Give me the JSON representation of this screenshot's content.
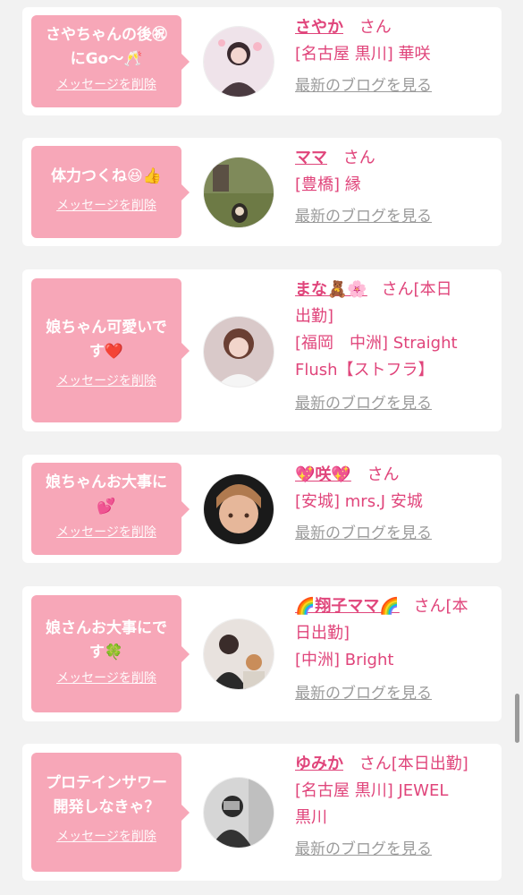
{
  "colors": {
    "accent_pink": "#e0457b",
    "bubble_pink": "#f7a7b8",
    "link_gray": "#9b9b9b",
    "page_bg": "#f2f2f2",
    "card_bg": "#ffffff"
  },
  "messages": [
    {
      "message_lines": [
        "さやちゃんの後㊗",
        "にGo〜🥂"
      ],
      "delete_label": "メッセージを削除",
      "name": "さやか",
      "honorific": "さん",
      "shop_lines": [
        "[名古屋 黒川] 華咲"
      ],
      "blog_label": "最新のブログを見る",
      "avatar_icon": "avatar-photo-icon"
    },
    {
      "message_lines": [
        "体力つくね😆👍"
      ],
      "delete_label": "メッセージを削除",
      "name": "ママ",
      "honorific": "さん",
      "shop_lines": [
        "[豊橋] 縁"
      ],
      "blog_label": "最新のブログを見る",
      "avatar_icon": "avatar-photo-icon"
    },
    {
      "message_lines": [
        "娘ちゃん可愛いで",
        "す❤️"
      ],
      "delete_label": "メッセージを削除",
      "name": "まな🧸🌸",
      "honorific": "さん[本日",
      "honorific_line2": "出勤]",
      "shop_lines": [
        "[福岡　中洲] Straight",
        "Flush【ストフラ】"
      ],
      "blog_label": "最新のブログを見る",
      "avatar_icon": "avatar-photo-icon"
    },
    {
      "message_lines": [
        "娘ちゃんお大事に",
        "💕"
      ],
      "delete_label": "メッセージを削除",
      "name": "💖咲💖",
      "honorific": "さん",
      "shop_lines": [
        "[安城] mrs.J 安城"
      ],
      "blog_label": "最新のブログを見る",
      "avatar_icon": "avatar-photo-icon"
    },
    {
      "message_lines": [
        "娘さんお大事にで",
        "す🍀"
      ],
      "delete_label": "メッセージを削除",
      "name": "🌈翔子ママ🌈",
      "honorific": "さん[本",
      "honorific_line2": "日出勤]",
      "shop_lines": [
        "[中洲] Bright"
      ],
      "blog_label": "最新のブログを見る",
      "avatar_icon": "avatar-photo-icon"
    },
    {
      "message_lines": [
        "プロテインサワー",
        "開発しなきゃ？"
      ],
      "delete_label": "メッセージを削除",
      "name": "ゆみか",
      "honorific": "さん[本日出勤]",
      "shop_lines": [
        "[名古屋 黒川] JEWEL",
        "黒川"
      ],
      "blog_label": "最新のブログを見る",
      "avatar_icon": "avatar-photo-icon"
    }
  ]
}
